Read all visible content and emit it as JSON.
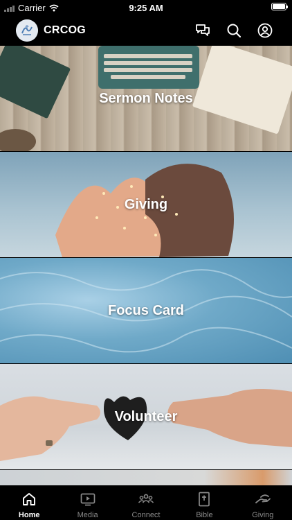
{
  "status_bar": {
    "carrier": "Carrier",
    "time": "9:25 AM",
    "battery_level": 1.0
  },
  "header": {
    "title": "CRCOG",
    "icons": [
      "chat-bubbles-icon",
      "search-icon",
      "user-account-icon"
    ]
  },
  "tiles": [
    {
      "label": "Sermon Notes"
    },
    {
      "label": "Giving"
    },
    {
      "label": "Focus Card"
    },
    {
      "label": "Volunteer"
    }
  ],
  "tab_bar": {
    "active": "Home",
    "items": [
      {
        "label": "Home",
        "icon": "home-icon"
      },
      {
        "label": "Media",
        "icon": "play-icon"
      },
      {
        "label": "Connect",
        "icon": "people-icon"
      },
      {
        "label": "Bible",
        "icon": "bible-icon"
      },
      {
        "label": "Giving",
        "icon": "giving-hand-icon"
      }
    ]
  },
  "colors": {
    "tab_active": "#ffffff",
    "tab_inactive": "#8a8a8a",
    "bar_background": "#000000"
  }
}
